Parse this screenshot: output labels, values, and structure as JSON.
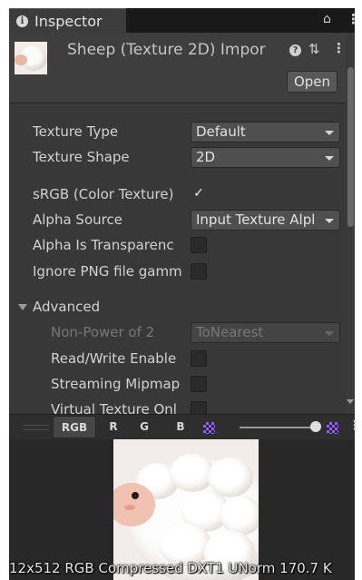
{
  "tab": {
    "title": "Inspector",
    "info_icon": "info-icon",
    "lock_icon": "lock-icon",
    "menu_icon": "kebab-menu-icon"
  },
  "header": {
    "asset_title": "Sheep (Texture 2D) Impor",
    "help_icon": "help-icon",
    "preset_icon": "preset-sliders-icon",
    "menu_icon": "kebab-menu-icon",
    "open_label": "Open"
  },
  "properties": {
    "texture_type": {
      "label": "Texture Type",
      "value": "Default"
    },
    "texture_shape": {
      "label": "Texture Shape",
      "value": "2D"
    },
    "srgb": {
      "label": "sRGB (Color Texture)",
      "checked": true,
      "mark": "✓"
    },
    "alpha_source": {
      "label": "Alpha Source",
      "value": "Input Texture Alpl"
    },
    "alpha_is_transparency": {
      "label": "Alpha Is Transparenc",
      "checked": false
    },
    "ignore_png_gamma": {
      "label": "Ignore PNG file gamm",
      "checked": false
    }
  },
  "advanced": {
    "label": "Advanced",
    "expanded": true,
    "non_power_of_2": {
      "label": "Non-Power of 2",
      "value": "ToNearest",
      "disabled": true
    },
    "read_write": {
      "label": "Read/Write Enable",
      "checked": false
    },
    "streaming_mipmaps": {
      "label": "Streaming Mipmap",
      "checked": false
    },
    "virtual_texture": {
      "label": "Virtual Texture Onl",
      "checked": false
    }
  },
  "preview_toolbar": {
    "channels": [
      "RGB",
      "R",
      "G",
      "B"
    ],
    "active_channel": "RGB",
    "mip_level_fraction": 1.0,
    "menu_icon": "kebab-menu-icon"
  },
  "preview": {
    "info": "12x512  RGB Compressed DXT1 UNorm   170.7 K"
  },
  "colors": {
    "panel": "#383838",
    "header": "#3e3e3e",
    "toolbar": "#2e2e2e",
    "preview_bg": "#282828",
    "sheep_face": "#f0c2b1"
  }
}
